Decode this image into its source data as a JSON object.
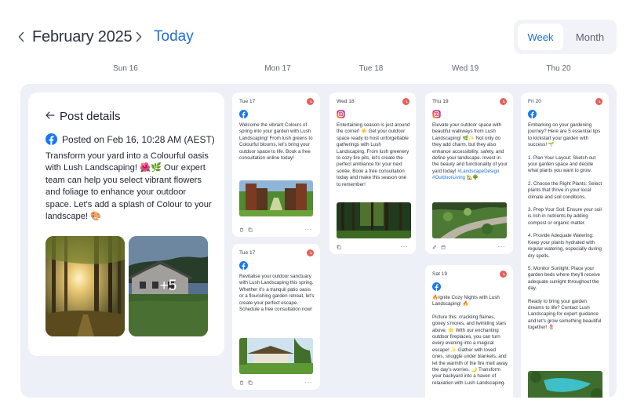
{
  "header": {
    "month_title": "February 2025",
    "today_label": "Today",
    "view_week": "Week",
    "view_month": "Month"
  },
  "days": [
    "Sun 16",
    "Mon 17",
    "Tue 18",
    "Wed 19",
    "Thu 20"
  ],
  "details": {
    "title": "Post details",
    "posted_on": "Posted on Feb 16, 10:28 AM (AEST)",
    "body": "Transform your yard into a Colourful oasis with Lush Landscaping! 🌺🌿 Our expert team can help you select vibrant flowers and foliage to enhance your outdoor space. Let's add a splash of Colour to your landscape! 🎨",
    "more_images": "+5"
  },
  "cards": {
    "tue17a": {
      "date": "Tue 17",
      "network": "facebook",
      "text": "Welcome the vibrant Colours of spring into your garden with Lush Landscaping! From lush greens to Colourful blooms, let's bring your outdoor space to life. Book a free consultation online today!"
    },
    "tue17b": {
      "date": "Tue 17",
      "network": "facebook",
      "text": "Revitalise your outdoor sanctuary with Lush Landscaping this spring. Whether it's a tranquil patio oasis or a flourishing garden retreat, let's create your perfect escape. Schedule a free consultation now!"
    },
    "wed18": {
      "date": "Wed 18",
      "network": "instagram",
      "text": "Entertaining season is just around the corner! ☀️ Get your outdoor space ready to host unforgettable gatherings with Lush Landscaping. From lush greenery to cozy fire pits, let's create the perfect ambiance for your next soirée. Book a free consultation today and make this season one to remember!"
    },
    "thu19": {
      "date": "Thu 19",
      "network": "instagram",
      "text": "Elevate your outdoor space with beautiful walkways from Lush Landscaping! 🌿✨ Not only do they add charm, but they also enhance accessibility, safety, and define your landscape. Invest in the beauty and functionality of your yard today!",
      "hashtags": "#LandscapeDesign #OutdoorLiving 🏡🌳"
    },
    "sat19": {
      "date": "Sat 19",
      "network": "facebook",
      "line1": "🔥Ignite Cozy Nights with Lush Landscaping! 🔥",
      "line2": "Picture this: crackling flames, gooey s'mores, and twinkling stars above. 🌟 With our enchanting outdoor fireplaces, you can turn every evening into a magical escape! ✨ Gather with loved ones, snuggle under blankets, and let the warmth of the fire melt away the day's worries. 🌙 Transform your backyard into a haven of relaxation with Lush Landscaping."
    },
    "fri20": {
      "date": "Fri 20",
      "network": "facebook",
      "p0": "Embarking on your gardening journey? Here are 5 essential tips to kickstart your garden with success! 🌱",
      "p1": "1. Plan Your Layout: Sketch out your garden space and decide what plants you want to grow.",
      "p2": "2. Choose the Right Plants: Select plants that thrive in your local climate and soil conditions.",
      "p3": "3. Prep Your Soil: Ensure your soil is rich in nutrients by adding compost or organic matter.",
      "p4": "4. Provide Adequate Watering: Keep your plants hydrated with regular watering, especially during dry spells.",
      "p5": "5. Monitor Sunlight: Place your garden beds where they'll receive adequate sunlight throughout the day.",
      "p6": "Ready to bring your garden dreams to life? Contact Lush Landscaping for expert guidance and let's grow something beautiful together! 🌷"
    }
  },
  "colors": {
    "accent": "#1f6fd6",
    "status_red": "#e4605a",
    "board_bg": "#eef0f7",
    "facebook": "#1877f2"
  }
}
